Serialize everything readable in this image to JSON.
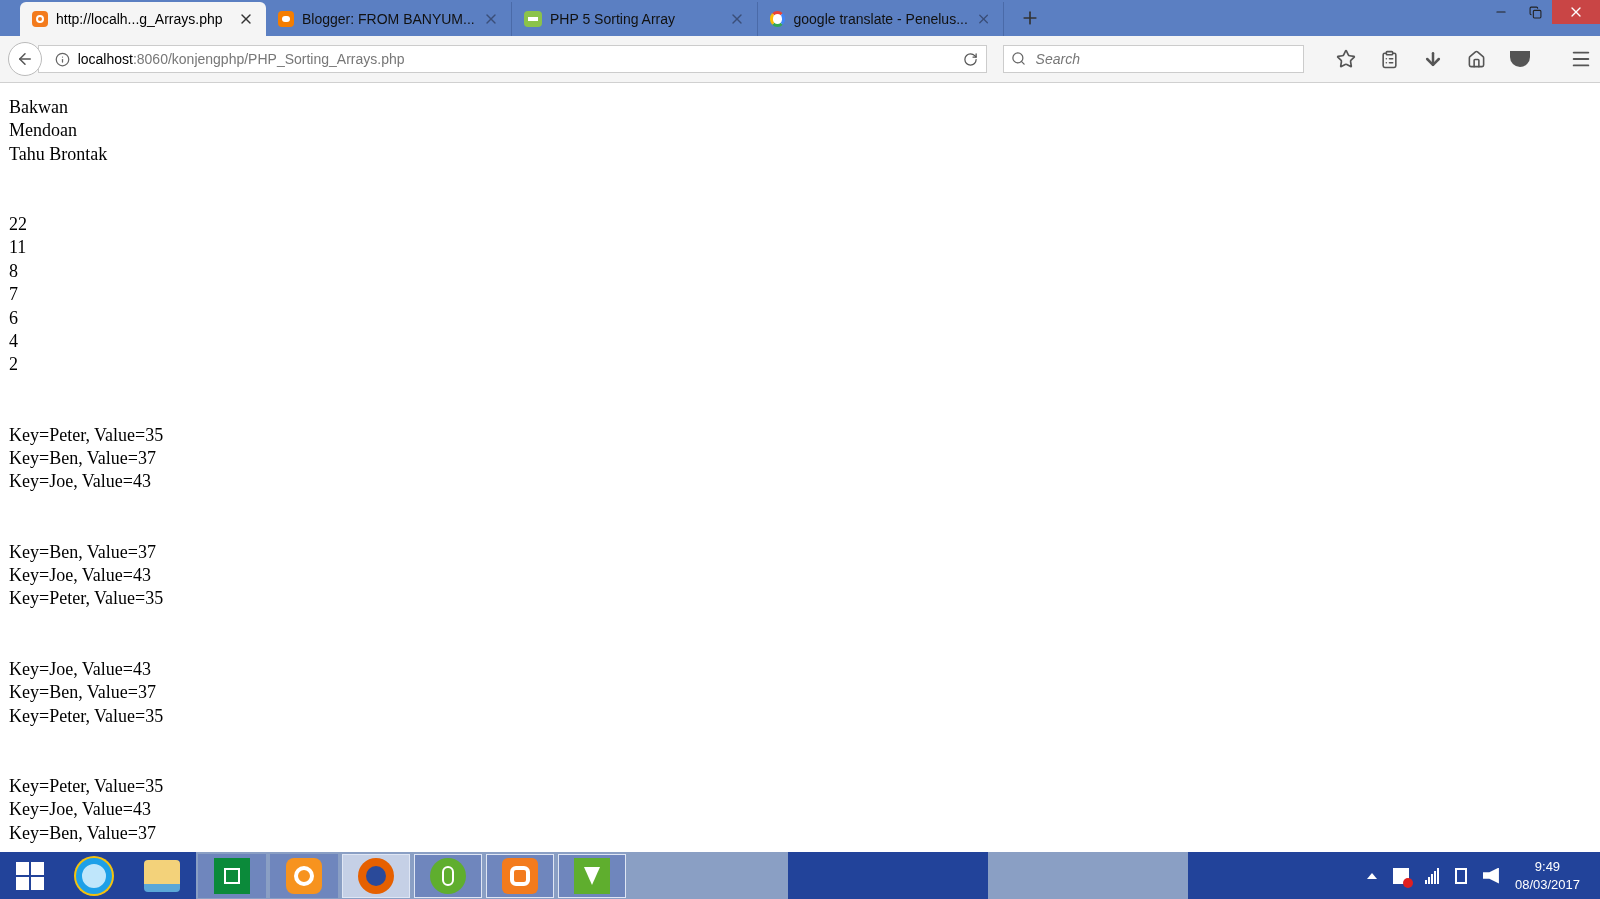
{
  "tabs": [
    {
      "title": "http://localh...g_Arrays.php",
      "kind": "xampp",
      "selected": true
    },
    {
      "title": "Blogger: FROM BANYUM...",
      "kind": "blogger",
      "selected": false
    },
    {
      "title": "PHP 5 Sorting Array",
      "kind": "w3",
      "selected": false
    },
    {
      "title": "google translate - Penelus...",
      "kind": "google",
      "selected": false
    }
  ],
  "address_bar": {
    "host": "localhost",
    "path": ":8060/konjengphp/PHP_Sorting_Arrays.php"
  },
  "search": {
    "placeholder": "Search"
  },
  "content": {
    "blocks": [
      [
        "Bakwan",
        "Mendoan",
        "Tahu Brontak"
      ],
      [
        "22",
        "11",
        "8",
        "7",
        "6",
        "4",
        "2"
      ],
      [
        "Key=Peter, Value=35",
        "Key=Ben, Value=37",
        "Key=Joe, Value=43"
      ],
      [
        "Key=Ben, Value=37",
        "Key=Joe, Value=43",
        "Key=Peter, Value=35"
      ],
      [
        "Key=Joe, Value=43",
        "Key=Ben, Value=37",
        "Key=Peter, Value=35"
      ],
      [
        "Key=Peter, Value=35",
        "Key=Joe, Value=43",
        "Key=Ben, Value=37"
      ]
    ]
  },
  "taskbar": {
    "apps": [
      {
        "kind": "ie",
        "running": false,
        "selected": false
      },
      {
        "kind": "explorer",
        "running": false,
        "selected": false
      },
      {
        "kind": "store",
        "running": false,
        "selected": false
      },
      {
        "kind": "uc",
        "running": false,
        "selected": false
      },
      {
        "kind": "firefox",
        "running": true,
        "selected": true
      },
      {
        "kind": "dreamweaver",
        "running": true,
        "selected": false
      },
      {
        "kind": "xampp",
        "running": true,
        "selected": false
      },
      {
        "kind": "corel",
        "running": true,
        "selected": false
      }
    ],
    "time": "9:49",
    "date": "08/03/2017"
  }
}
